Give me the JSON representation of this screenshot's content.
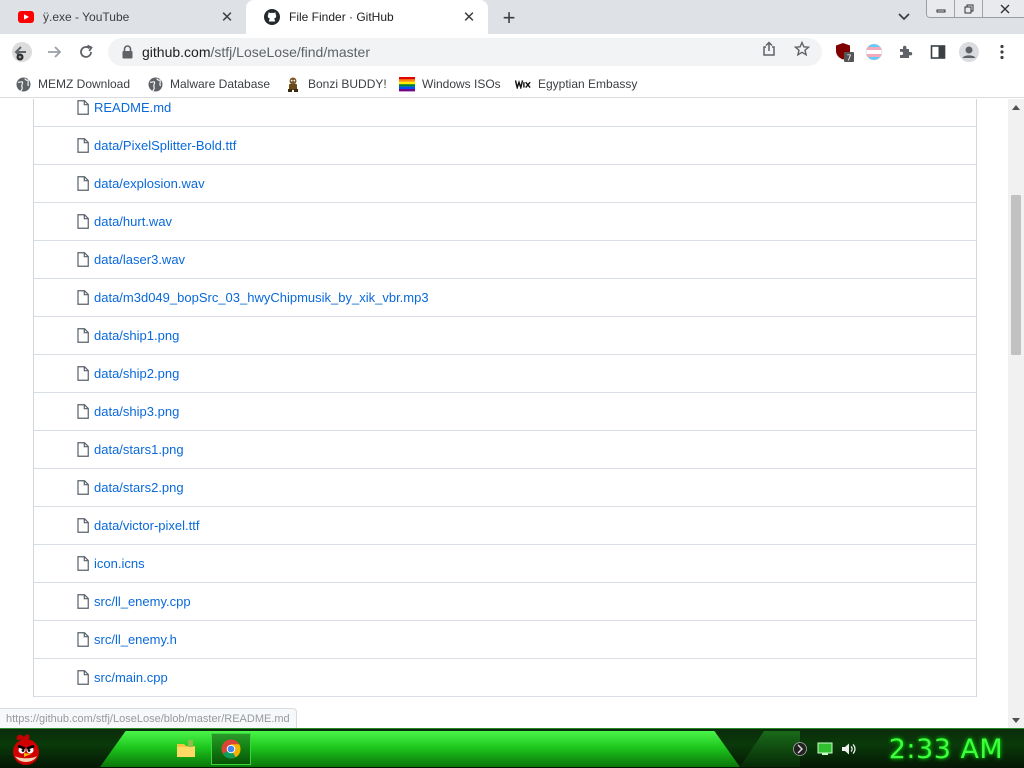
{
  "browser": {
    "tabs": [
      {
        "title": "ÿ.exe - YouTube",
        "favicon": "youtube-icon",
        "active": false
      },
      {
        "title": "File Finder · GitHub",
        "favicon": "github-icon",
        "active": true
      }
    ],
    "new_tab_label": "+",
    "close_glyph": "✕",
    "url": {
      "host": "github.com",
      "path": "/stfj/LoseLose/find/master"
    },
    "extension_badge": "7",
    "bookmarks": [
      {
        "label": "MEMZ Download",
        "icon": "globe-icon"
      },
      {
        "label": "Malware Database",
        "icon": "globe-icon"
      },
      {
        "label": "Bonzi BUDDY!",
        "icon": "bonzi-icon"
      },
      {
        "label": "Windows ISOs",
        "icon": "windows-icon"
      },
      {
        "label": "Egyptian Embassy",
        "icon": "wix-icon"
      }
    ]
  },
  "files": [
    "README.md",
    "data/PixelSplitter-Bold.ttf",
    "data/explosion.wav",
    "data/hurt.wav",
    "data/laser3.wav",
    "data/m3d049_bopSrc_03_hwyChipmusik_by_xik_vbr.mp3",
    "data/ship1.png",
    "data/ship2.png",
    "data/ship3.png",
    "data/stars1.png",
    "data/stars2.png",
    "data/victor-pixel.ttf",
    "icon.icns",
    "src/ll_enemy.cpp",
    "src/ll_enemy.h",
    "src/main.cpp"
  ],
  "status_url": "https://github.com/stfj/LoseLose/blob/master/README.md",
  "taskbar": {
    "clock": "2:33 AM",
    "accent": "#3dff3d"
  },
  "colors": {
    "link": "#0969da",
    "tab_strip": "#dee1e6"
  }
}
